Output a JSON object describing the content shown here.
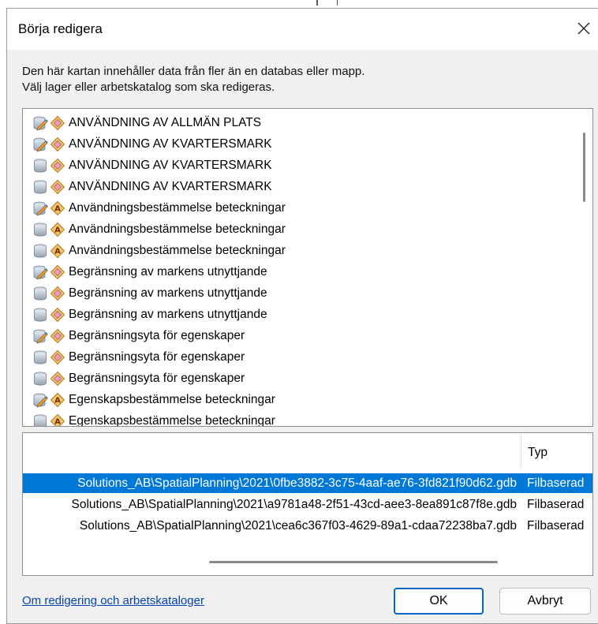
{
  "dialog": {
    "title": "Börja redigera",
    "description_line1": "Den här kartan innehåller data från fler än en databas eller mapp.",
    "description_line2": "Välj lager eller arbetskatalog som ska redigeras."
  },
  "layers": [
    {
      "label": "ANVÄNDNING AV ALLMÄN PLATS",
      "source_icon": "editable-layer-icon",
      "type_icon": "polygon-feature-icon"
    },
    {
      "label": "ANVÄNDNING AV KVARTERSMARK",
      "source_icon": "editable-layer-icon",
      "type_icon": "polygon-feature-icon"
    },
    {
      "label": "ANVÄNDNING AV KVARTERSMARK",
      "source_icon": "database-icon",
      "type_icon": "polygon-feature-icon"
    },
    {
      "label": "ANVÄNDNING AV KVARTERSMARK",
      "source_icon": "database-icon",
      "type_icon": "polygon-feature-icon"
    },
    {
      "label": "Användningsbestämmelse beteckningar",
      "source_icon": "editable-layer-icon",
      "type_icon": "annotation-icon"
    },
    {
      "label": "Användningsbestämmelse beteckningar",
      "source_icon": "database-icon",
      "type_icon": "annotation-icon"
    },
    {
      "label": "Användningsbestämmelse beteckningar",
      "source_icon": "database-icon",
      "type_icon": "annotation-icon"
    },
    {
      "label": "Begränsning av markens utnyttjande",
      "source_icon": "editable-layer-icon",
      "type_icon": "polygon-feature-icon"
    },
    {
      "label": "Begränsning av markens utnyttjande",
      "source_icon": "database-icon",
      "type_icon": "polygon-feature-icon"
    },
    {
      "label": "Begränsning av markens utnyttjande",
      "source_icon": "database-icon",
      "type_icon": "polygon-feature-icon"
    },
    {
      "label": "Begränsningsyta för egenskaper",
      "source_icon": "editable-layer-icon",
      "type_icon": "polygon-feature-icon"
    },
    {
      "label": "Begränsningsyta för egenskaper",
      "source_icon": "database-icon",
      "type_icon": "polygon-feature-icon"
    },
    {
      "label": "Begränsningsyta för egenskaper",
      "source_icon": "database-icon",
      "type_icon": "polygon-feature-icon"
    },
    {
      "label": "Egenskapsbestämmelse beteckningar",
      "source_icon": "editable-layer-icon",
      "type_icon": "annotation-icon"
    },
    {
      "label": "Egenskapsbestämmelse beteckningar",
      "source_icon": "database-icon",
      "type_icon": "annotation-icon"
    }
  ],
  "workspaces": {
    "column_type": "Typ",
    "rows": [
      {
        "path": "Solutions_AB\\SpatialPlanning\\2021\\0fbe3882-3c75-4aaf-ae76-3fd821f90d62.gdb",
        "type": "Filbaserad",
        "selected": true
      },
      {
        "path": "Solutions_AB\\SpatialPlanning\\2021\\a9781a48-2f51-43cd-aee3-8ea891c87f8e.gdb",
        "type": "Filbaserad",
        "selected": false
      },
      {
        "path": "Solutions_AB\\SpatialPlanning\\2021\\cea6c367f03-4629-89a1-cdaa72238ba7.gdb",
        "type": "Filbaserad",
        "selected": false
      }
    ]
  },
  "footer": {
    "help_link": "Om redigering och arbetskataloger",
    "ok_label": "OK",
    "cancel_label": "Avbryt"
  },
  "colors": {
    "selection": "#0078d7",
    "link": "#0645ad",
    "default_button_border": "#0067c0"
  }
}
